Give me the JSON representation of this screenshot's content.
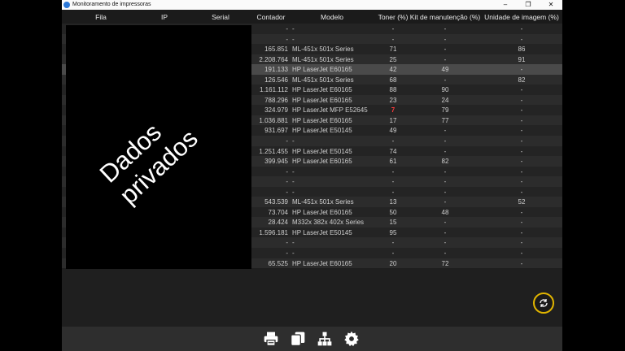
{
  "window": {
    "title": "Monitoramento de impressoras",
    "minimize": "–",
    "maximize": "❐",
    "close": "✕"
  },
  "columns": [
    "Fila",
    "IP",
    "Serial",
    "Contador",
    "Modelo",
    "Toner (%)",
    "Kit de manutenção (%)",
    "Unidade de imagem (%)"
  ],
  "private_label": "Dados privados",
  "toner_low_color": "#ff3b3b",
  "rows": [
    {
      "contador": "-",
      "modelo": "-",
      "toner": "-",
      "kit": "-",
      "unidade": "-"
    },
    {
      "contador": "-",
      "modelo": "-",
      "toner": "-",
      "kit": "-",
      "unidade": "-"
    },
    {
      "contador": "165.851",
      "modelo": "ML-451x 501x Series",
      "toner": "71",
      "kit": "-",
      "unidade": "86"
    },
    {
      "contador": "2.208.764",
      "modelo": "ML-451x 501x Series",
      "toner": "25",
      "kit": "-",
      "unidade": "91"
    },
    {
      "contador": "191.133",
      "modelo": "HP LaserJet E60165",
      "toner": "42",
      "kit": "49",
      "unidade": "-"
    },
    {
      "contador": "126.546",
      "modelo": "ML-451x 501x Series",
      "toner": "68",
      "kit": "-",
      "unidade": "82"
    },
    {
      "contador": "1.161.112",
      "modelo": "HP LaserJet E60165",
      "toner": "88",
      "kit": "90",
      "unidade": "-"
    },
    {
      "contador": "788.296",
      "modelo": "HP LaserJet E60165",
      "toner": "23",
      "kit": "24",
      "unidade": "-"
    },
    {
      "contador": "324.979",
      "modelo": "HP LaserJet MFP E52645",
      "toner": "7",
      "kit": "79",
      "unidade": "-"
    },
    {
      "contador": "1.036.881",
      "modelo": "HP LaserJet E60165",
      "toner": "17",
      "kit": "77",
      "unidade": "-"
    },
    {
      "contador": "931.697",
      "modelo": "HP LaserJet E50145",
      "toner": "49",
      "kit": "-",
      "unidade": "-"
    },
    {
      "contador": "-",
      "modelo": "-",
      "toner": "-",
      "kit": "-",
      "unidade": "-"
    },
    {
      "contador": "1.251.455",
      "modelo": "HP LaserJet E50145",
      "toner": "74",
      "kit": "-",
      "unidade": "-"
    },
    {
      "contador": "399.945",
      "modelo": "HP LaserJet E60165",
      "toner": "61",
      "kit": "82",
      "unidade": "-"
    },
    {
      "contador": "-",
      "modelo": "-",
      "toner": "-",
      "kit": "-",
      "unidade": "-"
    },
    {
      "contador": "-",
      "modelo": "-",
      "toner": "-",
      "kit": "-",
      "unidade": "-"
    },
    {
      "contador": "-",
      "modelo": "-",
      "toner": "-",
      "kit": "-",
      "unidade": "-"
    },
    {
      "contador": "543.539",
      "modelo": "ML-451x 501x Series",
      "toner": "13",
      "kit": "-",
      "unidade": "52"
    },
    {
      "contador": "73.704",
      "modelo": "HP LaserJet E60165",
      "toner": "50",
      "kit": "48",
      "unidade": "-"
    },
    {
      "contador": "28.424",
      "modelo": "M332x 382x 402x Series",
      "toner": "15",
      "kit": "-",
      "unidade": "-"
    },
    {
      "contador": "1.596.181",
      "modelo": "HP LaserJet E50145",
      "toner": "95",
      "kit": "-",
      "unidade": "-"
    },
    {
      "contador": "-",
      "modelo": "-",
      "toner": "-",
      "kit": "-",
      "unidade": "-"
    },
    {
      "contador": "-",
      "modelo": "-",
      "toner": "-",
      "kit": "-",
      "unidade": "-"
    },
    {
      "contador": "65.525",
      "modelo": "HP LaserJet E60165",
      "toner": "20",
      "kit": "72",
      "unidade": "-"
    }
  ],
  "toolbar": {
    "icons": [
      "printer-icon",
      "copies-icon",
      "network-icon",
      "gear-icon"
    ],
    "refresh_icon": "refresh-icon",
    "refresh_color": "#e0b400"
  }
}
